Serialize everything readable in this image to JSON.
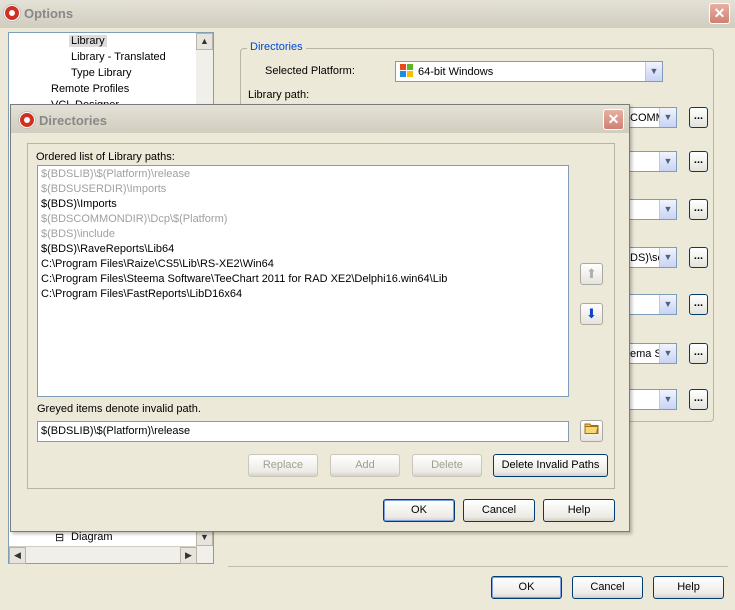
{
  "options_window": {
    "title": "Options",
    "tree": {
      "items": [
        {
          "label": "Library",
          "selected": true
        },
        {
          "label": "Library - Translated"
        },
        {
          "label": "Type Library"
        },
        {
          "label": "Remote Profiles"
        },
        {
          "label": "VCL Designer"
        }
      ],
      "bottom_item": "Diagram",
      "bottom_item_expander": "⊟"
    },
    "directories_group": {
      "title": "Directories",
      "platform_label": "Selected Platform:",
      "platform_value": "64-bit Windows",
      "library_path_label": "Library path:",
      "row_values": [
        "COMMON",
        "",
        "",
        "DS)\\sc",
        "",
        "ema S",
        ""
      ],
      "ellipsis": "..."
    },
    "buttons": {
      "ok": "OK",
      "cancel": "Cancel",
      "help": "Help"
    }
  },
  "directories_dialog": {
    "title": "Directories",
    "list_label": "Ordered list of Library paths:",
    "paths": [
      {
        "text": "$(BDSLIB)\\$(Platform)\\release",
        "valid": false
      },
      {
        "text": "$(BDSUSERDIR)\\Imports",
        "valid": false
      },
      {
        "text": "$(BDS)\\Imports",
        "valid": true
      },
      {
        "text": "$(BDSCOMMONDIR)\\Dcp\\$(Platform)",
        "valid": false
      },
      {
        "text": "$(BDS)\\include",
        "valid": false
      },
      {
        "text": "$(BDS)\\RaveReports\\Lib64",
        "valid": true
      },
      {
        "text": "C:\\Program Files\\Raize\\CS5\\Lib\\RS-XE2\\Win64",
        "valid": true
      },
      {
        "text": "C:\\Program Files\\Steema Software\\TeeChart 2011 for RAD XE2\\Delphi16.win64\\Lib",
        "valid": true
      },
      {
        "text": "C:\\Program Files\\FastReports\\LibD16x64",
        "valid": true
      }
    ],
    "hint": "Greyed items denote invalid path.",
    "edit_value": "$(BDSLIB)\\$(Platform)\\release",
    "buttons": {
      "replace": "Replace",
      "add": "Add",
      "delete": "Delete",
      "delete_invalid": "Delete Invalid Paths",
      "ok": "OK",
      "cancel": "Cancel",
      "help": "Help"
    },
    "colors": {
      "invalid_text": "#a0a0a0",
      "group_title": "#0046d5",
      "move_down_arrow": "#1040d0"
    }
  }
}
